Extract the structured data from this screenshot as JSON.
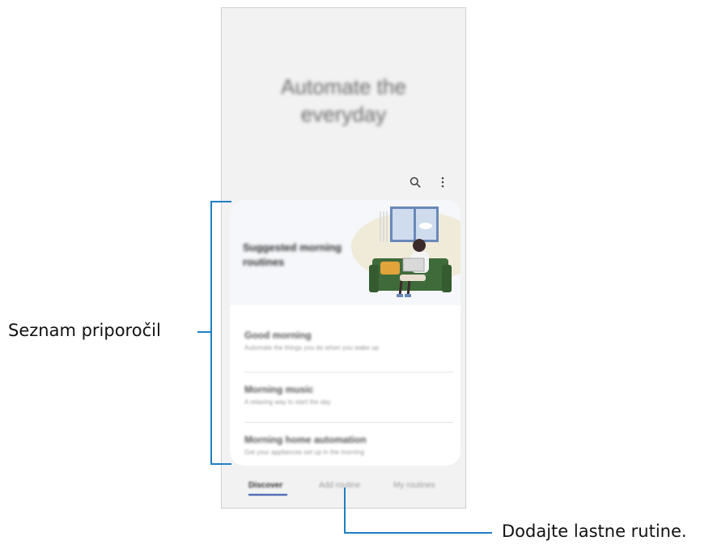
{
  "hero": {
    "line1": "Automate the",
    "line2": "everyday"
  },
  "toolbar": {
    "search_icon": "search-icon",
    "more_icon": "more-vert-icon"
  },
  "card": {
    "title": "Suggested morning routines",
    "routines": [
      {
        "title": "Good morning",
        "subtitle": "Automate the things you do when you wake up"
      },
      {
        "title": "Morning music",
        "subtitle": "A relaxing way to start the day"
      },
      {
        "title": "Morning home automation",
        "subtitle": "Get your appliances set up in the morning"
      }
    ]
  },
  "tabs": [
    {
      "label": "Discover"
    },
    {
      "label": "Add routine"
    },
    {
      "label": "My routines"
    }
  ],
  "callouts": {
    "left_label": "Seznam priporočil",
    "bottom_label": "Dodajte lastne rutine."
  },
  "colors": {
    "accent": "#1f7fc4",
    "tab_indicator": "#2a4fa8",
    "sofa": "#3f6b3a"
  }
}
